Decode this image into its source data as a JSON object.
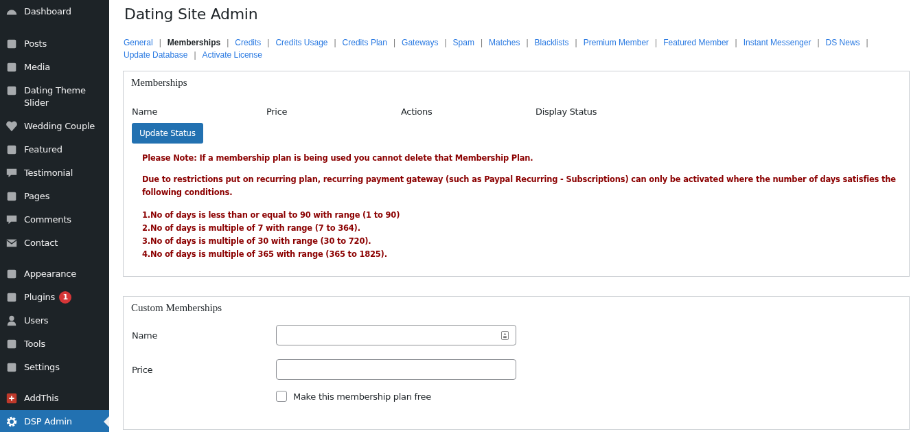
{
  "sidebar": {
    "groups": [
      [
        {
          "label": "Dashboard",
          "selected": false
        }
      ],
      [
        {
          "label": "Posts",
          "selected": false
        },
        {
          "label": "Media",
          "selected": false
        },
        {
          "label": "Dating Theme Slider",
          "selected": false
        },
        {
          "label": "Wedding Couple",
          "selected": false
        },
        {
          "label": "Featured",
          "selected": false
        },
        {
          "label": "Testimonial",
          "selected": false
        },
        {
          "label": "Pages",
          "selected": false
        },
        {
          "label": "Comments",
          "selected": false
        },
        {
          "label": "Contact",
          "selected": false
        }
      ],
      [
        {
          "label": "Appearance",
          "selected": false
        },
        {
          "label": "Plugins",
          "selected": false,
          "badge": "1"
        },
        {
          "label": "Users",
          "selected": false
        },
        {
          "label": "Tools",
          "selected": false
        },
        {
          "label": "Settings",
          "selected": false
        }
      ],
      [
        {
          "label": "AddThis",
          "selected": false
        },
        {
          "label": "DSP Admin",
          "selected": true
        }
      ]
    ]
  },
  "page_title": "Dating Site Admin",
  "nav": {
    "separator": "|",
    "links": [
      {
        "label": "General",
        "selected": false
      },
      {
        "label": "Memberships",
        "selected": true
      },
      {
        "label": "Credits",
        "selected": false
      },
      {
        "label": "Credits Usage",
        "selected": false
      },
      {
        "label": "Credits Plan",
        "selected": false
      },
      {
        "label": "Gateways",
        "selected": false
      },
      {
        "label": "Spam",
        "selected": false
      },
      {
        "label": "Matches",
        "selected": false
      },
      {
        "label": "Blacklists",
        "selected": false
      },
      {
        "label": "Premium Member",
        "selected": false
      },
      {
        "label": "Featured Member",
        "selected": false
      },
      {
        "label": "Instant Messenger",
        "selected": false
      },
      {
        "label": "DS News",
        "selected": false
      },
      {
        "label": "Update Database",
        "selected": false
      },
      {
        "label": "Activate License",
        "selected": false
      }
    ]
  },
  "memberships": {
    "title": "Memberships",
    "columns": [
      "Name",
      "Price",
      "Actions",
      "Display Status"
    ],
    "button": "Update Status",
    "note": "Please Note: If a membership plan is being used you cannot delete that Membership Plan.",
    "restriction": "Due to restrictions put on recurring plan, recurring payment gateway (such as Paypal Recurring - Subscriptions) can only be activated where the number of days satisfies the following conditions.",
    "conditions": [
      "1.No of days is less than or equal to 90 with range (1 to 90)",
      "2.No of days is multiple of 7 with range (7 to 364).",
      "3.No of days is multiple of 30 with range (30 to 720).",
      "4.No of days is multiple of 365 with range (365 to 1825)."
    ]
  },
  "custom_memberships": {
    "title": "Custom Memberships",
    "fields": [
      {
        "label": "Name"
      },
      {
        "label": "Price"
      }
    ],
    "free_checkbox": {
      "label": "Make this membership plan free",
      "checked": false
    }
  }
}
